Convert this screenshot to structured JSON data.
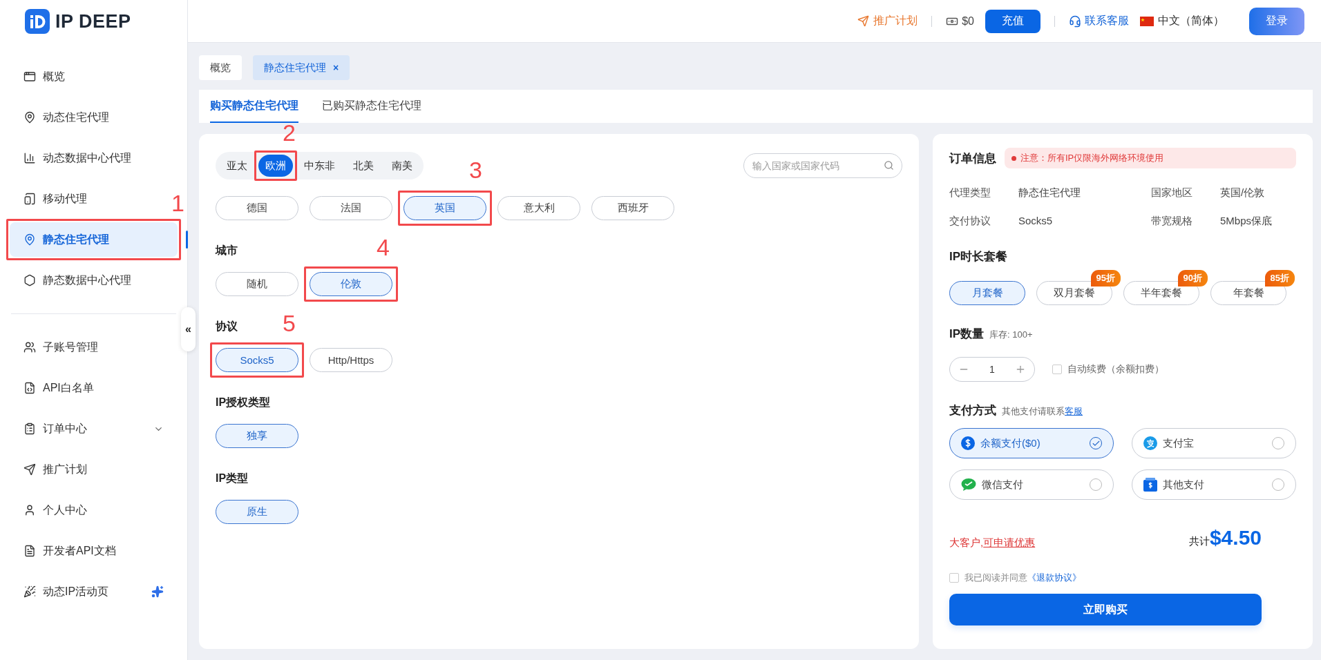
{
  "brand": {
    "name": "IP DEEP"
  },
  "topbar": {
    "promo": "推广计划",
    "balance": "$0",
    "recharge": "充值",
    "support": "联系客服",
    "language": "中文（简体）",
    "login": "登录"
  },
  "sidebar": {
    "main_items": [
      {
        "label": "概览",
        "selected": false
      },
      {
        "label": "动态住宅代理",
        "selected": false
      },
      {
        "label": "动态数据中心代理",
        "selected": false
      },
      {
        "label": "移动代理",
        "selected": false
      },
      {
        "label": "静态住宅代理",
        "selected": true,
        "callout": "1"
      },
      {
        "label": "静态数据中心代理",
        "selected": false
      }
    ],
    "account_items": [
      {
        "label": "子账号管理",
        "selected": false
      },
      {
        "label": "API白名单",
        "selected": false
      },
      {
        "label": "订单中心",
        "selected": false,
        "expanded": false
      },
      {
        "label": "推广计划",
        "selected": false
      },
      {
        "label": "个人中心",
        "selected": false
      },
      {
        "label": "开发者API文档",
        "selected": false
      },
      {
        "label": "动态IP活动页",
        "selected": false
      }
    ],
    "collapse": "«"
  },
  "page_tabs": [
    {
      "label": "概览",
      "selected": false
    },
    {
      "label": "静态住宅代理",
      "selected": true,
      "close": "×"
    }
  ],
  "sub_tabs": [
    {
      "label": "购买静态住宅代理",
      "selected": true
    },
    {
      "label": "已购买静态住宅代理",
      "selected": false
    }
  ],
  "regions": [
    {
      "label": "亚太",
      "selected": false
    },
    {
      "label": "欧洲",
      "selected": true,
      "callout": "2"
    },
    {
      "label": "中东非",
      "selected": false
    },
    {
      "label": "北美",
      "selected": false
    },
    {
      "label": "南美",
      "selected": false
    }
  ],
  "search": {
    "placeholder": "输入国家或国家代码"
  },
  "countries": [
    {
      "label": "德国",
      "selected": false
    },
    {
      "label": "法国",
      "selected": false
    },
    {
      "label": "英国",
      "selected": true,
      "callout": "3"
    },
    {
      "label": "意大利",
      "selected": false
    },
    {
      "label": "西班牙",
      "selected": false
    }
  ],
  "sections": [
    {
      "title": "城市",
      "options": [
        {
          "label": "随机",
          "selected": false
        },
        {
          "label": "伦敦",
          "selected": true,
          "callout": "4"
        }
      ]
    },
    {
      "title": "协议",
      "options": [
        {
          "label": "Socks5",
          "selected": true,
          "callout": "5"
        },
        {
          "label": "Http/Https",
          "selected": false
        }
      ]
    },
    {
      "title": "IP授权类型",
      "options": [
        {
          "label": "独享",
          "selected": true
        }
      ]
    },
    {
      "title": "IP类型",
      "options": [
        {
          "label": "原生",
          "selected": true
        }
      ]
    }
  ],
  "order": {
    "title": "订单信息",
    "notice": "注意：所有IP仅限海外网络环境使用",
    "details": [
      {
        "label": "代理类型",
        "value": "静态住宅代理"
      },
      {
        "label": "国家地区",
        "value": "英国/伦敦"
      },
      {
        "label": "交付协议",
        "value": "Socks5"
      },
      {
        "label": "带宽规格",
        "value": "5Mbps保底"
      }
    ],
    "plan_title": "IP时长套餐",
    "plans": [
      {
        "label": "月套餐",
        "selected": true
      },
      {
        "label": "双月套餐",
        "selected": false,
        "discount": "95折"
      },
      {
        "label": "半年套餐",
        "selected": false,
        "discount": "90折"
      },
      {
        "label": "年套餐",
        "selected": false,
        "discount": "85折"
      }
    ],
    "quantity": {
      "title": "IP数量",
      "stock": "库存: 100+",
      "value": "1"
    },
    "auto_renew": {
      "label": "自动续费（余额扣费）",
      "checked": false
    },
    "payment": {
      "title": "支付方式",
      "hint": "其他支付请联系",
      "hint_link": "客服",
      "methods": [
        {
          "label": "余额支付($0)",
          "selected": true
        },
        {
          "label": "支付宝",
          "selected": false
        },
        {
          "label": "微信支付",
          "selected": false
        },
        {
          "label": "其他支付",
          "selected": false
        }
      ]
    },
    "enterprise": {
      "text": "大客户,",
      "link": "可申请优惠"
    },
    "total": {
      "label": "共计",
      "amount": "$4.50"
    },
    "agreement": {
      "text": "我已阅读并同意",
      "link": "《退款协议》",
      "checked": false
    },
    "buy": "立即购买"
  }
}
